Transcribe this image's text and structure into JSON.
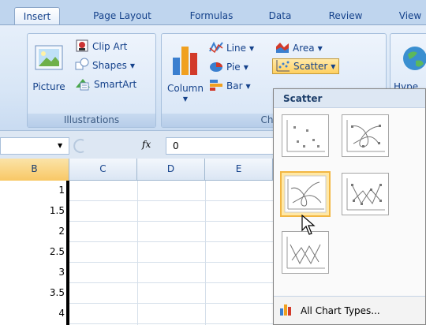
{
  "tabs": [
    {
      "label": "Insert",
      "active": true
    },
    {
      "label": "Page Layout",
      "active": false
    },
    {
      "label": "Formulas",
      "active": false
    },
    {
      "label": "Data",
      "active": false
    },
    {
      "label": "Review",
      "active": false
    },
    {
      "label": "View",
      "active": false
    }
  ],
  "ribbon": {
    "illustrations": {
      "picture": "Picture",
      "clip_art": "Clip Art",
      "shapes": "Shapes",
      "smartart": "SmartArt",
      "group_label": "Illustrations"
    },
    "charts": {
      "column": "Column",
      "line": "Line",
      "pie": "Pie",
      "bar": "Bar",
      "area": "Area",
      "scatter": "Scatter",
      "group_label": "Chart"
    },
    "hyperlink_partial": "Hype"
  },
  "formula_bar": {
    "fx": "fx",
    "value": "0"
  },
  "columns": [
    "B",
    "C",
    "D",
    "E"
  ],
  "rows": [
    "1",
    "1.5",
    "2",
    "2.5",
    "3",
    "3.5",
    "4"
  ],
  "scatter_menu": {
    "title": "Scatter",
    "thumbnails": [
      {
        "name": "scatter-markers-only"
      },
      {
        "name": "scatter-smooth-lines-markers"
      },
      {
        "name": "scatter-smooth-lines",
        "hovered": true
      },
      {
        "name": "scatter-straight-lines-markers"
      },
      {
        "name": "scatter-straight-lines"
      }
    ],
    "all_chart_types": "All Chart Types..."
  }
}
